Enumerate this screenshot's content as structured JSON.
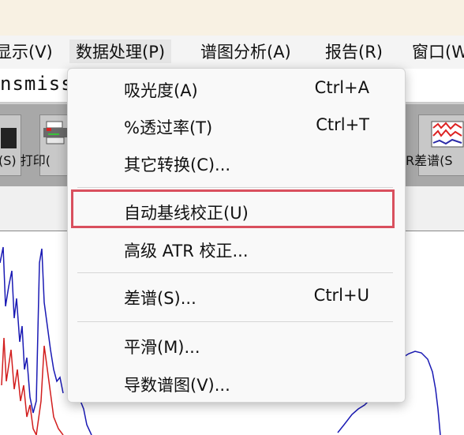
{
  "menubar": {
    "items": [
      {
        "label": "显示(V)"
      },
      {
        "label": "数据处理(P)"
      },
      {
        "label": "谱图分析(A)"
      },
      {
        "label": "报告(R)"
      },
      {
        "label": "窗口(W"
      }
    ]
  },
  "address": {
    "text": "nsmiss"
  },
  "toolbar": {
    "left_label": "(S) 打印(",
    "right_label": "R差谱(S"
  },
  "dropdown": {
    "items": [
      {
        "label": "吸光度(A)",
        "shortcut": "Ctrl+A"
      },
      {
        "label": "%透过率(T)",
        "shortcut": "Ctrl+T"
      },
      {
        "label": "其它转换(C)...",
        "shortcut": ""
      },
      {
        "label": "自动基线校正(U)",
        "shortcut": ""
      },
      {
        "label": "高级 ATR 校正...",
        "shortcut": ""
      },
      {
        "label": "差谱(S)...",
        "shortcut": "Ctrl+U"
      },
      {
        "label": "平滑(M)...",
        "shortcut": ""
      },
      {
        "label": "导数谱图(V)...",
        "shortcut": ""
      }
    ]
  },
  "colors": {
    "highlight_border": "#d9505e",
    "spectrum_blue": "#1a1ab4",
    "spectrum_red": "#d21e1e"
  }
}
